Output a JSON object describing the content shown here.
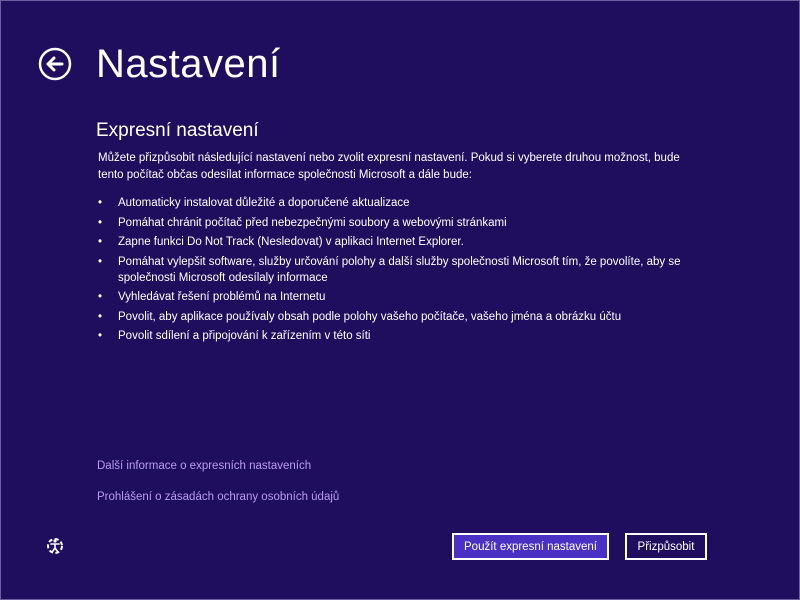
{
  "header": {
    "title": "Nastavení",
    "back_icon": "back-arrow-icon"
  },
  "section": {
    "title": "Expresní nastavení",
    "intro": "Můžete přizpůsobit následující nastavení nebo zvolit expresní nastavení. Pokud si vyberete druhou možnost, bude tento počítač občas odesílat informace společnosti Microsoft a dále bude:"
  },
  "features": [
    "Automaticky instalovat důležité a doporučené aktualizace",
    "Pomáhat chránit počítač před nebezpečnými soubory a webovými stránkami",
    "Zapne funkci Do Not Track (Nesledovat) v aplikaci Internet Explorer.",
    "Pomáhat vylepšit software, služby určování polohy a další služby společnosti Microsoft tím, že povolíte, aby se společnosti Microsoft odesílaly informace",
    "Vyhledávat řešení problémů na Internetu",
    "Povolit, aby aplikace používaly obsah podle polohy vašeho počítače, vašeho jména a obrázku účtu",
    "Povolit sdílení a připojování k zařízením v této síti"
  ],
  "links": {
    "more_info": "Další informace o expresních nastaveních",
    "privacy": "Prohlášení o zásadách ochrany osobních údajů"
  },
  "buttons": {
    "use_express": "Použít expresní nastavení",
    "customize": "Přizpůsobit"
  },
  "icons": {
    "ease_of_access": "ease-of-access-icon"
  },
  "colors": {
    "background": "#1f0e5e",
    "primary_button": "#4a30c4",
    "link": "#b79cf0",
    "text": "#ffffff"
  }
}
